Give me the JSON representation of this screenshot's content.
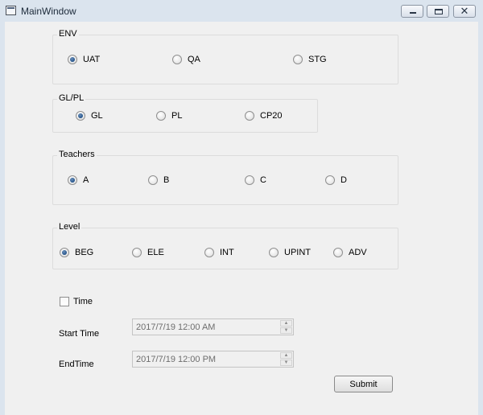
{
  "window": {
    "title": "MainWindow"
  },
  "groups": {
    "env": {
      "title": "ENV",
      "options": [
        {
          "label": "UAT",
          "selected": true
        },
        {
          "label": "QA",
          "selected": false
        },
        {
          "label": "STG",
          "selected": false
        }
      ]
    },
    "glpl": {
      "title": "GL/PL",
      "options": [
        {
          "label": "GL",
          "selected": true
        },
        {
          "label": "PL",
          "selected": false
        },
        {
          "label": "CP20",
          "selected": false
        }
      ]
    },
    "teachers": {
      "title": "Teachers",
      "options": [
        {
          "label": "A",
          "selected": true
        },
        {
          "label": "B",
          "selected": false
        },
        {
          "label": "C",
          "selected": false
        },
        {
          "label": "D",
          "selected": false
        }
      ]
    },
    "level": {
      "title": "Level",
      "options": [
        {
          "label": "BEG",
          "selected": true
        },
        {
          "label": "ELE",
          "selected": false
        },
        {
          "label": "INT",
          "selected": false
        },
        {
          "label": "UPINT",
          "selected": false
        },
        {
          "label": "ADV",
          "selected": false
        }
      ]
    }
  },
  "time": {
    "label": "Time",
    "checked": false
  },
  "start_time": {
    "label": "Start Time",
    "value": "2017/7/19 12:00 AM"
  },
  "end_time": {
    "label": "EndTime",
    "value": "2017/7/19 12:00 PM"
  },
  "submit": {
    "label": "Submit"
  }
}
